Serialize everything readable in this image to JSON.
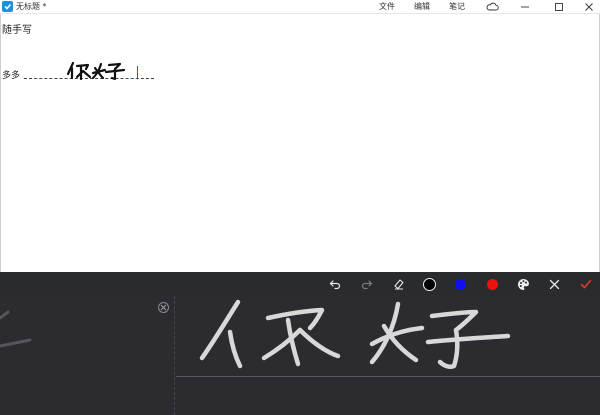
{
  "window": {
    "title": "无标题 *",
    "menus": [
      "文件",
      "编辑",
      "笔记"
    ],
    "icons": {
      "app": "app-icon",
      "cloud": "cloud-icon",
      "minimize": "minimize-icon",
      "maximize": "maximize-icon",
      "close": "close-icon"
    }
  },
  "document": {
    "heading": "随手写",
    "line_text": "多多",
    "handwriting_text": "你好"
  },
  "toolbar": {
    "tools": [
      "undo-icon",
      "redo-icon",
      "eraser-icon",
      "pen-black",
      "pen-blue",
      "pen-red",
      "palette-icon",
      "close-icon",
      "confirm-icon"
    ],
    "colors": {
      "black": "#000000",
      "blue": "#1010ee",
      "red": "#ee1111",
      "confirm": "#e03a2a"
    }
  },
  "pad": {
    "background": "#2c2c30",
    "ink_color": "#d8d8d8"
  }
}
